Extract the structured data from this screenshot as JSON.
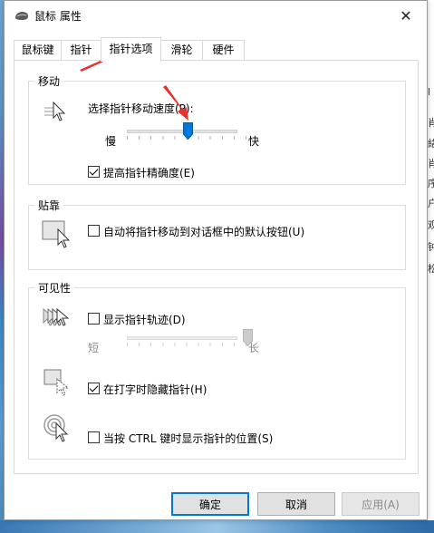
{
  "window": {
    "title": "鼠标 属性",
    "close_glyph": "✕"
  },
  "tabs": [
    {
      "label": "鼠标键",
      "active": false
    },
    {
      "label": "指针",
      "active": false
    },
    {
      "label": "指针选项",
      "active": true
    },
    {
      "label": "滑轮",
      "active": false
    },
    {
      "label": "硬件",
      "active": false
    }
  ],
  "motion": {
    "group_label": "移动",
    "speed_label": "选择指针移动速度(P):",
    "slow_label": "慢",
    "fast_label": "快",
    "speed_value": 6,
    "speed_max": 11,
    "precision_label": "提高指针精确度(E)",
    "precision_checked": true
  },
  "snap": {
    "group_label": "贴靠",
    "snap_label": "自动将指针移动到对话框中的默认按钮(U)",
    "snap_checked": false
  },
  "visibility": {
    "group_label": "可见性",
    "trails_label": "显示指针轨迹(D)",
    "trails_checked": false,
    "short_label": "短",
    "long_label": "长",
    "trail_value": 10,
    "trail_max": 11,
    "hide_label": "在打字时隐藏指针(H)",
    "hide_checked": true,
    "ctrl_label": "当按 CTRL 键时显示指针的位置(S)",
    "ctrl_checked": false
  },
  "buttons": {
    "ok": "确定",
    "cancel": "取消",
    "apply": "应用(A)"
  },
  "background_right_chars": [
    "l",
    "肖",
    "絡",
    "肖",
    "序",
    "户",
    "观",
    "钟",
    "松"
  ],
  "colors": {
    "accent": "#0078d7",
    "annotation": "#e5322d"
  }
}
